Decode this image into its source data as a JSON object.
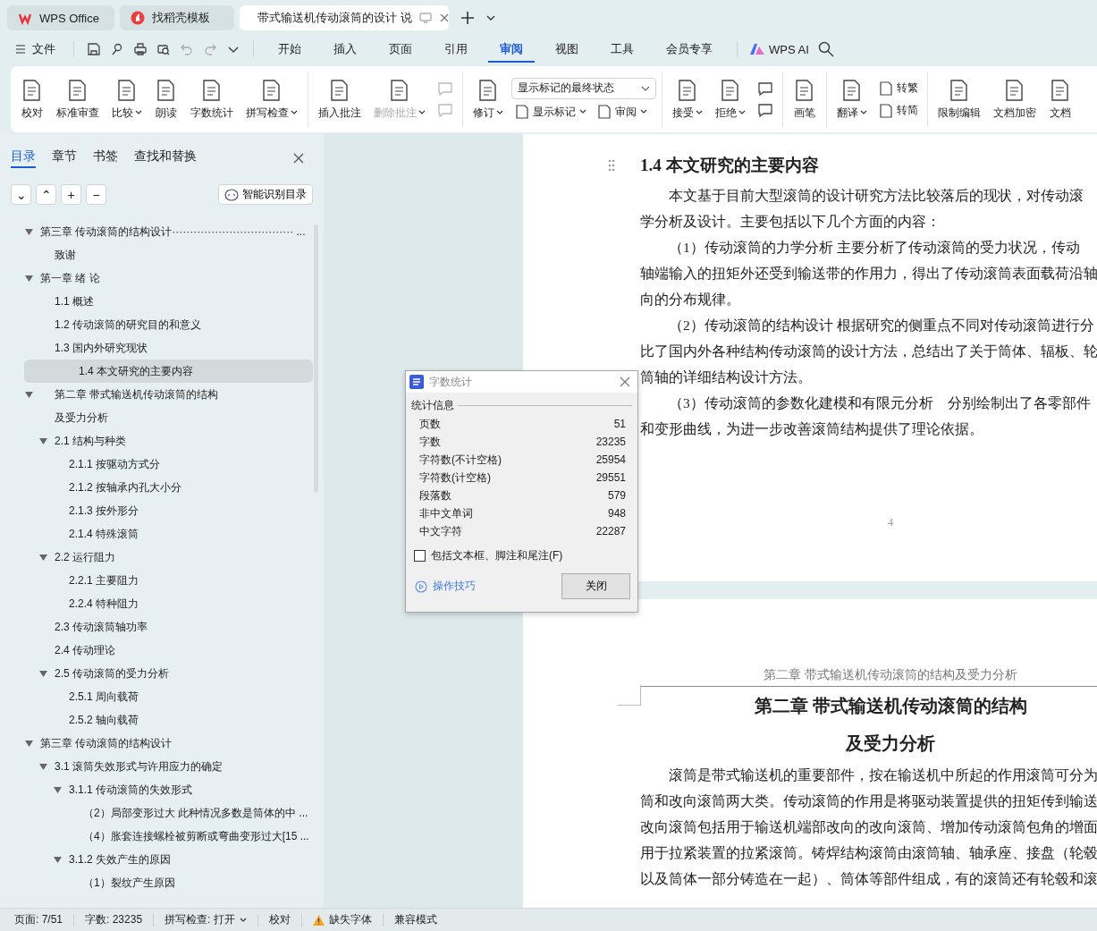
{
  "window_tabs": [
    {
      "label": "WPS Office",
      "kind": "home",
      "selected": false
    },
    {
      "label": "找稻壳模板",
      "kind": "template",
      "selected": false
    },
    {
      "label": "带式输送机传动滚筒的设计 说",
      "kind": "document",
      "selected": true
    }
  ],
  "menu": {
    "file": "文件",
    "tabs": [
      {
        "label": "开始",
        "selected": false
      },
      {
        "label": "插入",
        "selected": false
      },
      {
        "label": "页面",
        "selected": false
      },
      {
        "label": "引用",
        "selected": false
      },
      {
        "label": "审阅",
        "selected": true
      },
      {
        "label": "视图",
        "selected": false
      },
      {
        "label": "工具",
        "selected": false
      },
      {
        "label": "会员专享",
        "selected": false
      }
    ],
    "ai": "WPS AI"
  },
  "ribbon": {
    "groups": [
      {
        "columns": [
          [
            {
              "kind": "large",
              "label": "校对",
              "caret": false,
              "disabled": false
            }
          ],
          [
            {
              "kind": "large",
              "label": "标准审查",
              "caret": false,
              "disabled": false
            }
          ],
          [
            {
              "kind": "large",
              "label": "比较",
              "caret": true,
              "disabled": false
            }
          ],
          [
            {
              "kind": "large",
              "label": "朗读",
              "caret": false,
              "disabled": false
            }
          ],
          [
            {
              "kind": "large",
              "label": "字数统计",
              "caret": false,
              "disabled": false
            }
          ],
          [
            {
              "kind": "large",
              "label": "拼写检查",
              "caret": true,
              "disabled": false
            }
          ]
        ]
      },
      {
        "columns": [
          [
            {
              "kind": "large",
              "label": "插入批注",
              "caret": false,
              "disabled": false
            }
          ],
          [
            {
              "kind": "large",
              "label": "删除批注",
              "caret": true,
              "disabled": true
            }
          ],
          [
            {
              "kind": "icon",
              "disabled": true
            },
            {
              "kind": "icon",
              "disabled": true
            }
          ]
        ]
      },
      {
        "columns": [
          [
            {
              "kind": "large",
              "label": "修订",
              "caret": true,
              "disabled": false
            }
          ],
          [
            {
              "kind": "select",
              "value": "显示标记的最终状态",
              "disabled": false
            },
            {
              "kind": "row",
              "items": [
                {
                  "kind": "small",
                  "label": "显示标记",
                  "caret": true,
                  "disabled": false
                },
                {
                  "kind": "small",
                  "label": "审阅",
                  "caret": true,
                  "disabled": false
                }
              ]
            }
          ]
        ]
      },
      {
        "columns": [
          [
            {
              "kind": "large",
              "label": "接受",
              "caret": true,
              "disabled": false
            }
          ],
          [
            {
              "kind": "large",
              "label": "拒绝",
              "caret": true,
              "disabled": false
            }
          ],
          [
            {
              "kind": "icon",
              "disabled": false
            },
            {
              "kind": "icon",
              "disabled": false
            }
          ]
        ]
      },
      {
        "columns": [
          [
            {
              "kind": "large",
              "label": "画笔",
              "caret": false,
              "disabled": false
            }
          ]
        ]
      },
      {
        "columns": [
          [
            {
              "kind": "large",
              "label": "翻译",
              "caret": true,
              "disabled": false
            }
          ],
          [
            {
              "kind": "small",
              "label": "转繁",
              "caret": false,
              "disabled": false
            },
            {
              "kind": "small",
              "label": "转简",
              "caret": false,
              "disabled": false
            }
          ]
        ]
      },
      {
        "columns": [
          [
            {
              "kind": "large",
              "label": "限制编辑",
              "caret": false,
              "disabled": false
            }
          ],
          [
            {
              "kind": "large",
              "label": "文档加密",
              "caret": false,
              "disabled": false
            }
          ],
          [
            {
              "kind": "large",
              "label": "文档",
              "caret": false,
              "disabled": false
            }
          ]
        ]
      }
    ]
  },
  "nav": {
    "tabs": [
      {
        "label": "目录",
        "selected": true
      },
      {
        "label": "章节",
        "selected": false
      },
      {
        "label": "书签",
        "selected": false
      },
      {
        "label": "查找和替换",
        "selected": false
      }
    ],
    "tools": [
      "⌄",
      "⌃",
      "+",
      "−"
    ],
    "smart_button": "智能识别目录",
    "toc": [
      {
        "label": "第三章  传动滚筒的结构设计··································  ...",
        "selected": false,
        "expanded": true,
        "children": [
          {
            "label": "致谢",
            "selected": false
          }
        ]
      },
      {
        "label": "第一章  绪  论",
        "selected": false,
        "expanded": true,
        "children": [
          {
            "label": "1.1  概述",
            "selected": false
          },
          {
            "label": "1.2  传动滚筒的研究目的和意义",
            "selected": false
          },
          {
            "label": "1.3  国内外研究现状",
            "selected": false
          },
          {
            "label": "1.4  本文研究的主要内容",
            "selected": true
          }
        ]
      },
      {
        "label_lines": [
          "第二章  带式输送机传动滚筒的结构",
          "及受力分析"
        ],
        "selected": false,
        "expanded": true,
        "children": [
          {
            "label": "2.1  结构与种类",
            "selected": false,
            "expanded": true,
            "children": [
              {
                "label": "2.1.1  按驱动方式分",
                "selected": false
              },
              {
                "label": "2.1.2  按轴承内孔大小分",
                "selected": false
              },
              {
                "label": "2.1.3  按外形分",
                "selected": false
              },
              {
                "label": "2.1.4  特殊滚筒",
                "selected": false
              }
            ]
          },
          {
            "label": " 2.2  运行阻力",
            "selected": false,
            "expanded": true,
            "children": [
              {
                "label": "2.2.1  主要阻力",
                "selected": false
              },
              {
                "label": "2.2.4  特种阻力",
                "selected": false
              }
            ]
          },
          {
            "label": "2.3  传动滚筒轴功率",
            "selected": false
          },
          {
            "label": "2.4  传动理论",
            "selected": false
          },
          {
            "label": "2.5  传动滚筒的受力分析",
            "selected": false,
            "expanded": true,
            "children": [
              {
                "label": "2.5.1  周向载荷",
                "selected": false
              },
              {
                "label": "2.5.2  轴向载荷",
                "selected": false
              }
            ]
          }
        ]
      },
      {
        "label": "第三章  传动滚筒的结构设计",
        "selected": false,
        "expanded": true,
        "children": [
          {
            "label": "3.1  滚筒失效形式与许用应力的确定",
            "selected": false,
            "expanded": true,
            "children": [
              {
                "label": "3.1.1  传动滚筒的失效形式",
                "selected": false,
                "expanded": true,
                "children": [
                  {
                    "label": "（2）局部变形过大  此种情况多数是筒体的中 ...",
                    "selected": false
                  },
                  {
                    "label": "（4）胀套连接螺栓被剪断或弯曲变形过大[15 ...",
                    "selected": false
                  }
                ]
              },
              {
                "label": "3.1.2  失效产生的原因",
                "selected": false,
                "expanded": true,
                "children": [
                  {
                    "label": "（1）裂纹产生原因",
                    "selected": false
                  }
                ]
              }
            ]
          }
        ]
      }
    ]
  },
  "document": {
    "pages": [
      {
        "heading": "1.4  本文研究的主要内容",
        "paragraphs": [
          [
            "本文基于目前大型滚筒的设计研究方法比较落后的现状，对传动滚",
            "学分析及设计。主要包括以下几个方面的内容："
          ],
          [
            "（1）传动滚筒的力学分析 主要分析了传动滚筒的受力状况，传动",
            "轴端输入的扭矩外还受到输送带的作用力，得出了传动滚筒表面载荷沿轴",
            "向的分布规律。"
          ],
          [
            "（2）传动滚筒的结构设计 根据研究的侧重点不同对传动滚筒进行分",
            "比了国内外各种结构传动滚筒的设计方法，总结出了关于筒体、辐板、轮",
            "筒轴的详细结构设计方法。"
          ],
          [
            "（3）传动滚筒的参数化建模和有限元分析　分别绘制出了各零部件",
            "和变形曲线，为进一步改善滚筒结构提供了理论依据。"
          ]
        ],
        "page_number": "4"
      },
      {
        "header": "第二章  带式输送机传动滚筒的结构及受力分析",
        "title": [
          "第二章  带式输送机传动滚筒的结构",
          "及受力分析"
        ],
        "paragraphs": [
          [
            "滚筒是带式输送机的重要部件，按在输送机中所起的作用滚筒可分为",
            "筒和改向滚筒两大类。传动滚筒的作用是将驱动装置提供的扭矩传到输送",
            "改向滚筒包括用于输送机端部改向的改向滚筒、增加传动滚筒包角的增面",
            "用于拉紧装置的拉紧滚筒。铸焊结构滚筒由滚筒轴、轴承座、接盘（轮毂",
            "以及筒体一部分铸造在一起）、筒体等部件组成，有的滚筒还有轮毂和滚"
          ]
        ]
      }
    ]
  },
  "dialog": {
    "title": "字数统计",
    "section": "统计信息",
    "rows": [
      {
        "label": "页数",
        "value": "51"
      },
      {
        "label": "字数",
        "value": "23235"
      },
      {
        "label": "字符数(不计空格)",
        "value": "25954"
      },
      {
        "label": "字符数(计空格)",
        "value": "29551"
      },
      {
        "label": "段落数",
        "value": "579"
      },
      {
        "label": "非中文单词",
        "value": "948"
      },
      {
        "label": "中文字符",
        "value": "22287"
      }
    ],
    "checkbox": {
      "label": "包括文本框、脚注和尾注(F)",
      "checked": false
    },
    "tips": "操作技巧",
    "close_button": "关闭"
  },
  "status_bar": [
    {
      "kind": "text",
      "label": "页面: 7/51"
    },
    {
      "kind": "text",
      "label": "字数: 23235"
    },
    {
      "kind": "dropdown",
      "label": "拼写检查: 打开"
    },
    {
      "kind": "text",
      "label": "校对"
    },
    {
      "kind": "warning",
      "label": "缺失字体"
    },
    {
      "kind": "text",
      "label": "兼容模式"
    }
  ]
}
